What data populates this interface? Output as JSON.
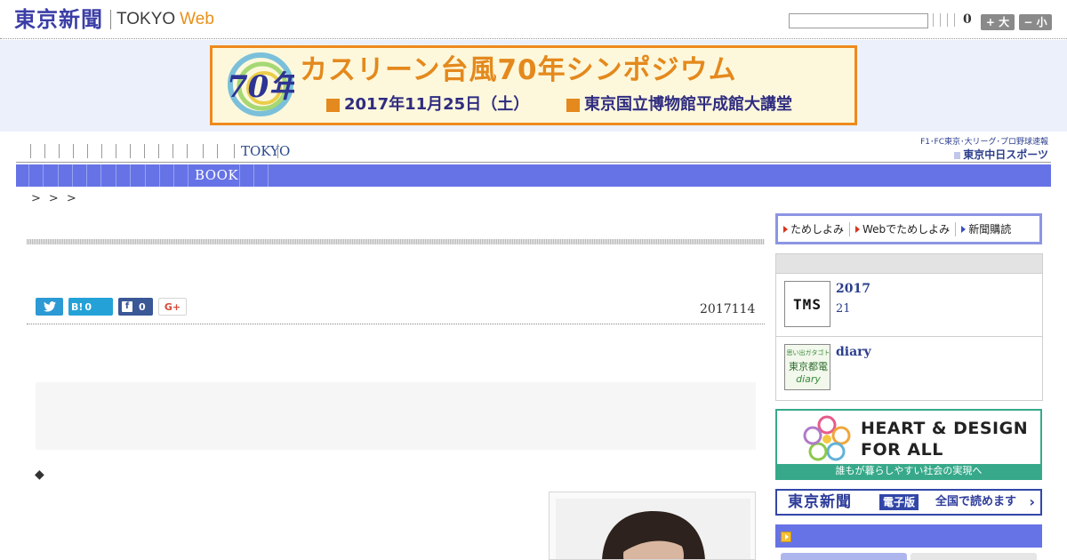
{
  "header": {
    "logo_main": "東京新聞",
    "logo_sub_1": "TOKYO",
    "logo_sub_2": "Web",
    "search_value": "",
    "font_count": "0",
    "font_large": "+ 大",
    "font_small": "− 小"
  },
  "banner": {
    "logo_text": "70年",
    "title": "カスリーン台風70年シンポジウム",
    "date_line": "2017年11月25日（土）",
    "place_line": "東京国立博物館平成館大講堂"
  },
  "nav_primary": {
    "tokyo": "TOKYO"
  },
  "chunichi": {
    "top": "F1･FC東京･大リーグ･プロ野球速報",
    "bottom": "東京中日スポーツ"
  },
  "nav_secondary": {
    "book": "BOOK"
  },
  "breadcrumb": [
    ">",
    ">",
    ">"
  ],
  "article": {
    "date": "2017114",
    "bullet": "◆"
  },
  "social": {
    "hatena_label": "B!",
    "hatena_count": "0",
    "facebook_count": "0",
    "google_label": "G+"
  },
  "sidebar": {
    "tabs": [
      "ためしよみ",
      "Webでためしよみ",
      "新聞購読"
    ],
    "items": [
      {
        "thumb": "TMS",
        "title": "2017",
        "sub": "21"
      },
      {
        "thumb_top": "思い出ガタゴト",
        "thumb_mid": "東京都電",
        "thumb_bottom": "diary",
        "title": "diary"
      }
    ],
    "heart_ad": {
      "line1": "HEART & DESIGN",
      "line2": "FOR ALL",
      "footer": "誰もが暮らしやすい社会の実現へ"
    },
    "denshi": {
      "name": "東京新聞",
      "badge": "電子版",
      "text": "全国で読めます",
      "chevron": "›"
    }
  },
  "colors": {
    "brand_blue": "#3b3ea6",
    "nav_blue": "#6673e6",
    "banner_orange": "#ee8a1c",
    "heart_green": "#37a98a"
  }
}
